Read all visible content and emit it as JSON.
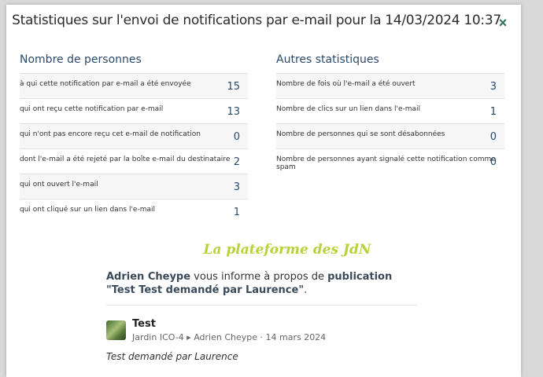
{
  "modal": {
    "title": "Statistiques sur l'envoi de notifications par e-mail pour la 14/03/2024 10:37",
    "close_label": "×"
  },
  "left": {
    "heading": "Nombre de personnes",
    "rows": [
      {
        "label": "à qui cette notification par e-mail a été envoyée",
        "value": "15"
      },
      {
        "label": "qui ont reçu cette notification par e-mail",
        "value": "13"
      },
      {
        "label": "qui n'ont pas encore reçu cet e-mail de notification",
        "value": "0"
      },
      {
        "label": "dont l'e-mail a été rejeté par la boîte e-mail du destinataire",
        "value": "2"
      },
      {
        "label": "qui ont ouvert l'e-mail",
        "value": "3"
      },
      {
        "label": "qui ont cliqué sur un lien dans l'e-mail",
        "value": "1"
      }
    ]
  },
  "right": {
    "heading": "Autres statistiques",
    "rows": [
      {
        "label": "Nombre de fois où l'e-mail a été ouvert",
        "value": "3"
      },
      {
        "label": "Nombre de clics sur un lien dans l'e-mail",
        "value": "1"
      },
      {
        "label": "Nombre de personnes qui se sont désabonnées",
        "value": "0"
      },
      {
        "label": "Nombre de personnes ayant signalé cette notification comme spam",
        "value": "0"
      }
    ]
  },
  "preview": {
    "brand": "La plateforme des JdN",
    "sender": "Adrien Cheype",
    "info_mid": " vous informe à propos de ",
    "publication": "publication \"Test Test demandé par Laurence\"",
    "info_end": ".",
    "post_author": "Test",
    "post_meta": "Jardin ICO-4 ▸ Adrien Cheype · 14 mars 2024",
    "post_body": "Test demandé par Laurence"
  }
}
